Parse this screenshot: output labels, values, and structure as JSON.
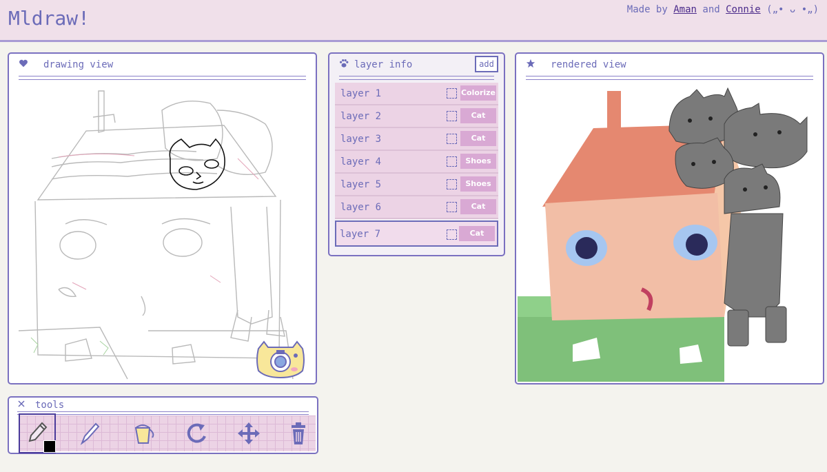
{
  "app": {
    "title": "Mldraw!",
    "credits_prefix": "Made by",
    "author1": "Aman",
    "credits_and": "and",
    "author2": "Connie",
    "credits_emoticon": "(„• ᴗ •„)"
  },
  "panels": {
    "drawing": {
      "title": "drawing view",
      "icon": "heart-icon"
    },
    "layers": {
      "title": "layer info",
      "icon": "paw-icon",
      "add_label": "add"
    },
    "rendered": {
      "title": "rendered view",
      "icon": "star-icon"
    },
    "tools": {
      "title": "tools",
      "icon": "close-icon"
    }
  },
  "layers": [
    {
      "name": "layer 1",
      "model": "Colorize"
    },
    {
      "name": "layer 2",
      "model": "Cat"
    },
    {
      "name": "layer 3",
      "model": "Cat"
    },
    {
      "name": "layer 4",
      "model": "Shoes"
    },
    {
      "name": "layer 5",
      "model": "Shoes"
    },
    {
      "name": "layer 6",
      "model": "Cat"
    },
    {
      "name": "layer 7",
      "model": "Cat",
      "selected": true
    }
  ],
  "tools": [
    {
      "name": "pencil-tool",
      "icon": "pencil-icon",
      "active": true
    },
    {
      "name": "brush-tool",
      "icon": "brush-icon"
    },
    {
      "name": "fill-tool",
      "icon": "bucket-icon"
    },
    {
      "name": "undo-tool",
      "icon": "rotate-icon"
    },
    {
      "name": "move-tool",
      "icon": "move-icon"
    },
    {
      "name": "delete-tool",
      "icon": "trash-icon"
    }
  ],
  "colors": {
    "accent": "#6b6bb8",
    "topbar": "#f0e0ea",
    "layer_row": "#ecd3e5",
    "model_tag": "#d9a9d4",
    "current_color": "#000000"
  }
}
